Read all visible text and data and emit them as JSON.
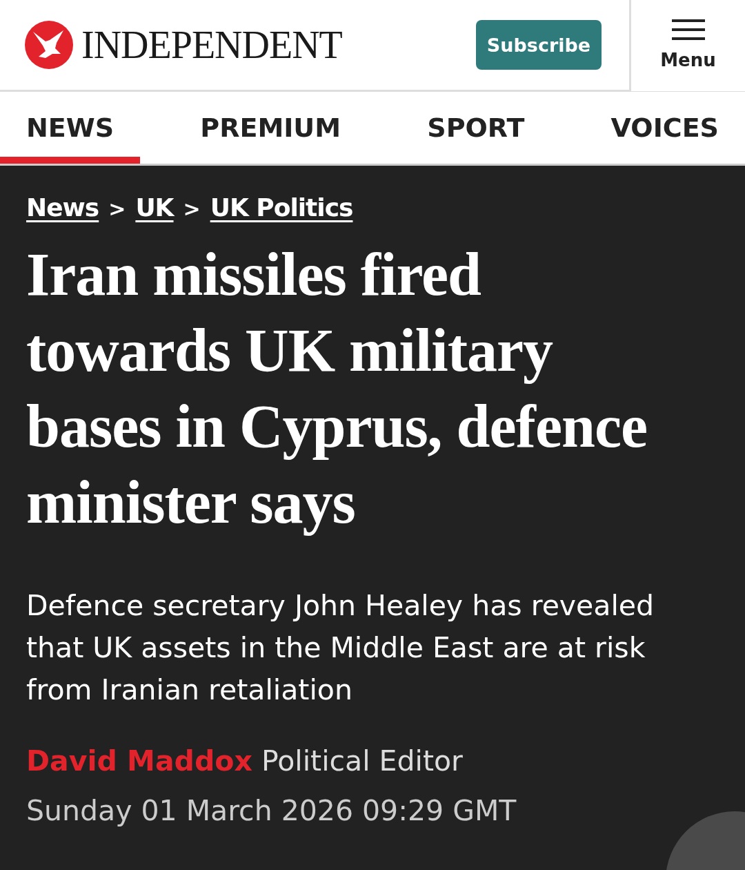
{
  "header": {
    "logo_text": "INDEPENDENT",
    "subscribe": "Subscribe",
    "menu": "Menu"
  },
  "tabs": [
    {
      "label": "NEWS",
      "selected": true
    },
    {
      "label": "PREMIUM",
      "selected": false
    },
    {
      "label": "SPORT",
      "selected": false
    },
    {
      "label": "VOICES",
      "selected": false
    }
  ],
  "breadcrumbs": [
    "News",
    "UK",
    "UK Politics"
  ],
  "breadcrumb_separator": ">",
  "headline": "Iran missiles fired towards UK military bases in Cyprus, defence minister says",
  "standfirst": "Defence secretary John Healey has revealed that UK assets in the Middle East are at risk from Iranian retaliation",
  "byline": {
    "author": "David Maddox",
    "role": "Political Editor"
  },
  "date": "Sunday 01 March 2026 09:29 GMT"
}
